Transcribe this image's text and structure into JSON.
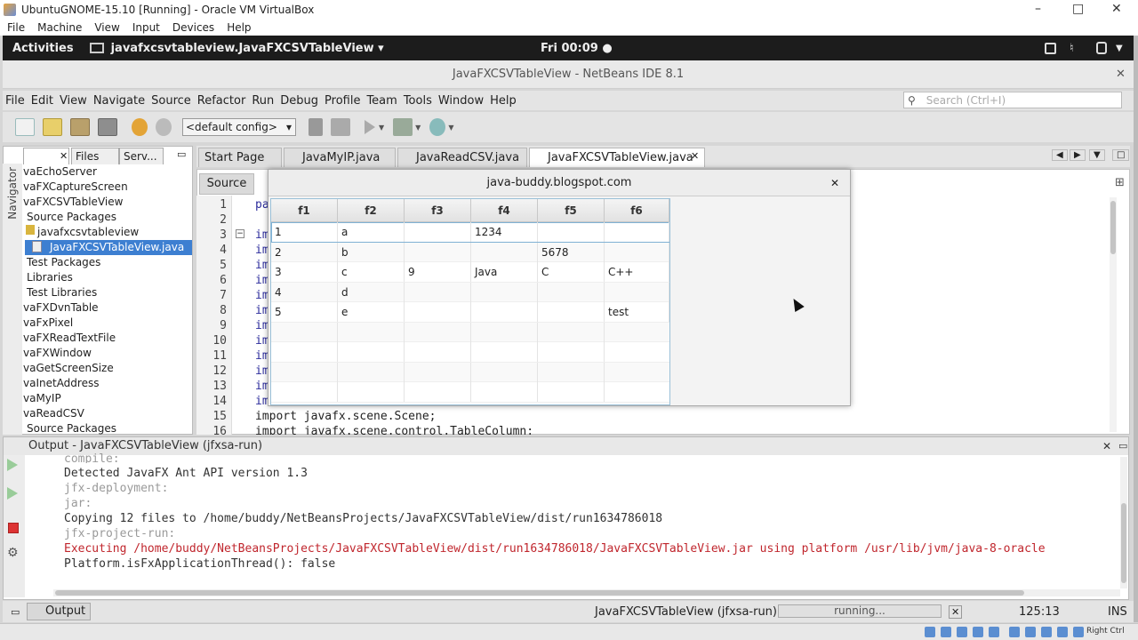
{
  "vbox": {
    "title": "UbuntuGNOME-15.10 [Running] - Oracle VM VirtualBox",
    "menu": [
      "File",
      "Machine",
      "View",
      "Input",
      "Devices",
      "Help"
    ],
    "min": "–",
    "max": "□",
    "close": "✕"
  },
  "gnome": {
    "activities": "Activities",
    "app": "javafxcsvtableview.JavaFXCSVTableView ▾",
    "clock": "Fri 00:09 ●"
  },
  "netbeans": {
    "title": "JavaFXCSVTableView - NetBeans IDE 8.1",
    "menu": [
      "File",
      "Edit",
      "View",
      "Navigate",
      "Source",
      "Refactor",
      "Run",
      "Debug",
      "Profile",
      "Team",
      "Tools",
      "Window",
      "Help"
    ],
    "search_placeholder": "Search (Ctrl+I)",
    "config": "<default config>",
    "left_tabs": [
      "",
      "Files",
      "Serv..."
    ],
    "navigator_label": "Navigator",
    "tree": [
      "vaEchoServer",
      "vaFXCaptureScreen",
      "vaFXCSVTableView",
      "Source Packages",
      "javafxcsvtableview",
      "JavaFXCSVTableView.java",
      "Test Packages",
      "Libraries",
      "Test Libraries",
      "vaFXDvnTable",
      "vaFxPixel",
      "vaFXReadTextFile",
      "vaFXWindow",
      "vaGetScreenSize",
      "vaInetAddress",
      "vaMyIP",
      "vaReadCSV",
      "Source Packages"
    ],
    "editor_tabs": [
      "Start Page",
      "JavaMyIP.java",
      "JavaReadCSV.java",
      "JavaFXCSVTableView.java"
    ],
    "source_tab": "Source",
    "line_numbers": [
      "1",
      "2",
      "3",
      "4",
      "5",
      "6",
      "7",
      "8",
      "9",
      "10",
      "11",
      "12",
      "13",
      "14",
      "15",
      "16"
    ],
    "code_lines": [
      "pa",
      "",
      "im",
      "im",
      "im",
      "im",
      "im",
      "im",
      "im",
      "im",
      "im",
      "im",
      "im",
      "im",
      "import javafx.scene.Scene;",
      "import javafx.scene.control.TableColumn;"
    ]
  },
  "fx_window": {
    "title": "java-buddy.blogspot.com",
    "close": "✕",
    "headers": [
      "f1",
      "f2",
      "f3",
      "f4",
      "f5",
      "f6"
    ],
    "rows": [
      [
        "1",
        "a",
        "",
        "1234",
        "",
        ""
      ],
      [
        "2",
        "b",
        "",
        "",
        "5678",
        ""
      ],
      [
        "3",
        "c",
        "9",
        "Java",
        "C",
        "C++"
      ],
      [
        "4",
        "d",
        "",
        "",
        "",
        ""
      ],
      [
        "5",
        "e",
        "",
        "",
        "",
        "test"
      ]
    ]
  },
  "output": {
    "title": "Output - JavaFXCSVTableView (jfxsa-run)",
    "lines": [
      {
        "text": "compile:",
        "color": "#9a9a9a"
      },
      {
        "text": "Detected JavaFX Ant API version 1.3",
        "color": "#333333"
      },
      {
        "text": "jfx-deployment:",
        "color": "#9a9a9a"
      },
      {
        "text": "jar:",
        "color": "#9a9a9a"
      },
      {
        "text": "Copying 12 files to /home/buddy/NetBeansProjects/JavaFXCSVTableView/dist/run1634786018",
        "color": "#333333"
      },
      {
        "text": "jfx-project-run:",
        "color": "#9a9a9a"
      },
      {
        "text": "Executing /home/buddy/NetBeansProjects/JavaFXCSVTableView/dist/run1634786018/JavaFXCSVTableView.jar using platform /usr/lib/jvm/java-8-oracle",
        "color": "#c0262d"
      },
      {
        "text": "Platform.isFxApplicationThread(): false",
        "color": "#333333"
      }
    ]
  },
  "status": {
    "output_tab": "Output",
    "task": "JavaFXCSVTableView (jfxsa-run)",
    "progress": "running...",
    "position": "125:13",
    "mode": "INS"
  },
  "tray": {
    "host_key": "Right Ctrl"
  }
}
